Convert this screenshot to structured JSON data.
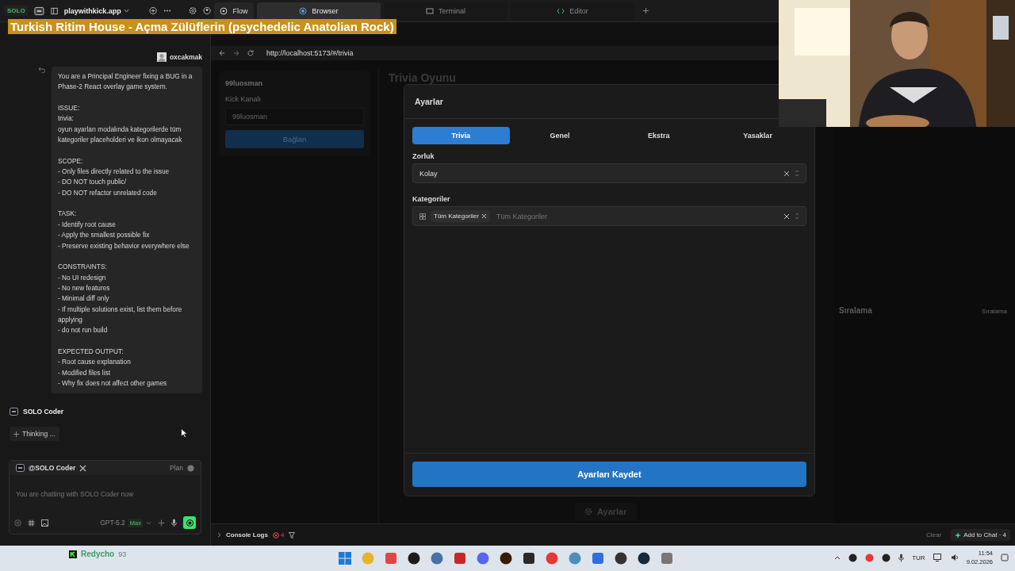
{
  "app": {
    "logo": "SOLO",
    "workspace": "playwithkick.app",
    "tabs": [
      {
        "label": "Flow",
        "selected": false
      },
      {
        "label": "Browser",
        "selected": true
      },
      {
        "label": "Terminal",
        "selected": false
      },
      {
        "label": "Editor",
        "selected": false
      }
    ]
  },
  "now_playing": "Turkish Ritim House - Açma Zülüflerin (psychedelic Anatolian Rock)",
  "chat": {
    "user": "oxcakmak",
    "message": "You are a Principal Engineer fixing a BUG in a Phase-2 React overlay game system.\n\nISSUE:\ntrivia:\noyun ayarları modalında kategorilerde tüm kategoriler placeholderi ve ikon olmayacak\n\nSCOPE:\n- Only files directly related to the issue\n- DO NOT touch public/\n- DO NOT refactor unrelated code\n\nTASK:\n- Identify root cause\n- Apply the smallest possible fix\n- Preserve existing behavior everywhere else\n\nCONSTRAINTS:\n- No UI redesign\n- No new features\n- Minimal diff only\n- If multiple solutions exist, list them before applying\n- do not run build\n\nEXPECTED OUTPUT:\n- Root cause explanation\n- Modified files list\n- Why fix does not affect other games",
    "agent": "SOLO Coder",
    "status": "Thinking ...",
    "input": {
      "mention": "@SOLO Coder",
      "mode": "Plan",
      "placeholder": "You are chatting with SOLO Coder now",
      "model": "GPT-5.2",
      "model_badge": "Max"
    }
  },
  "browser": {
    "url": "http://localhost:5173/#/trivia",
    "card": {
      "title": "99luosman",
      "field_label": "Kick Kanalı",
      "field_value": "99luosman",
      "button": "Bağlan"
    },
    "page_title": "Trivia Oyunu",
    "ranking_title": "Sıralama",
    "ranking_label": "Sıralama",
    "settings_button": "Ayarlar"
  },
  "modal": {
    "title": "Ayarlar",
    "tabs": [
      {
        "label": "Trivia",
        "selected": true
      },
      {
        "label": "Genel",
        "selected": false
      },
      {
        "label": "Ekstra",
        "selected": false
      },
      {
        "label": "Yasaklar",
        "selected": false
      }
    ],
    "fields": [
      {
        "kind": "select",
        "label": "Zorluk",
        "value": "Kolay"
      },
      {
        "kind": "multiselect",
        "label": "Kategoriler",
        "tags": [
          "Tüm Kategoriler"
        ],
        "placeholder": "Tüm Kategoriler"
      }
    ],
    "save": "Ayarları Kaydet"
  },
  "console": {
    "label": "Console Logs",
    "errors": "4",
    "clear": "Clear",
    "add": "Add to Chat · 4"
  },
  "taskbar": {
    "overlay_name": "Redycho",
    "overlay_count": "93",
    "lang": "TUR",
    "time": "11:54",
    "date": "9.02.2026"
  }
}
